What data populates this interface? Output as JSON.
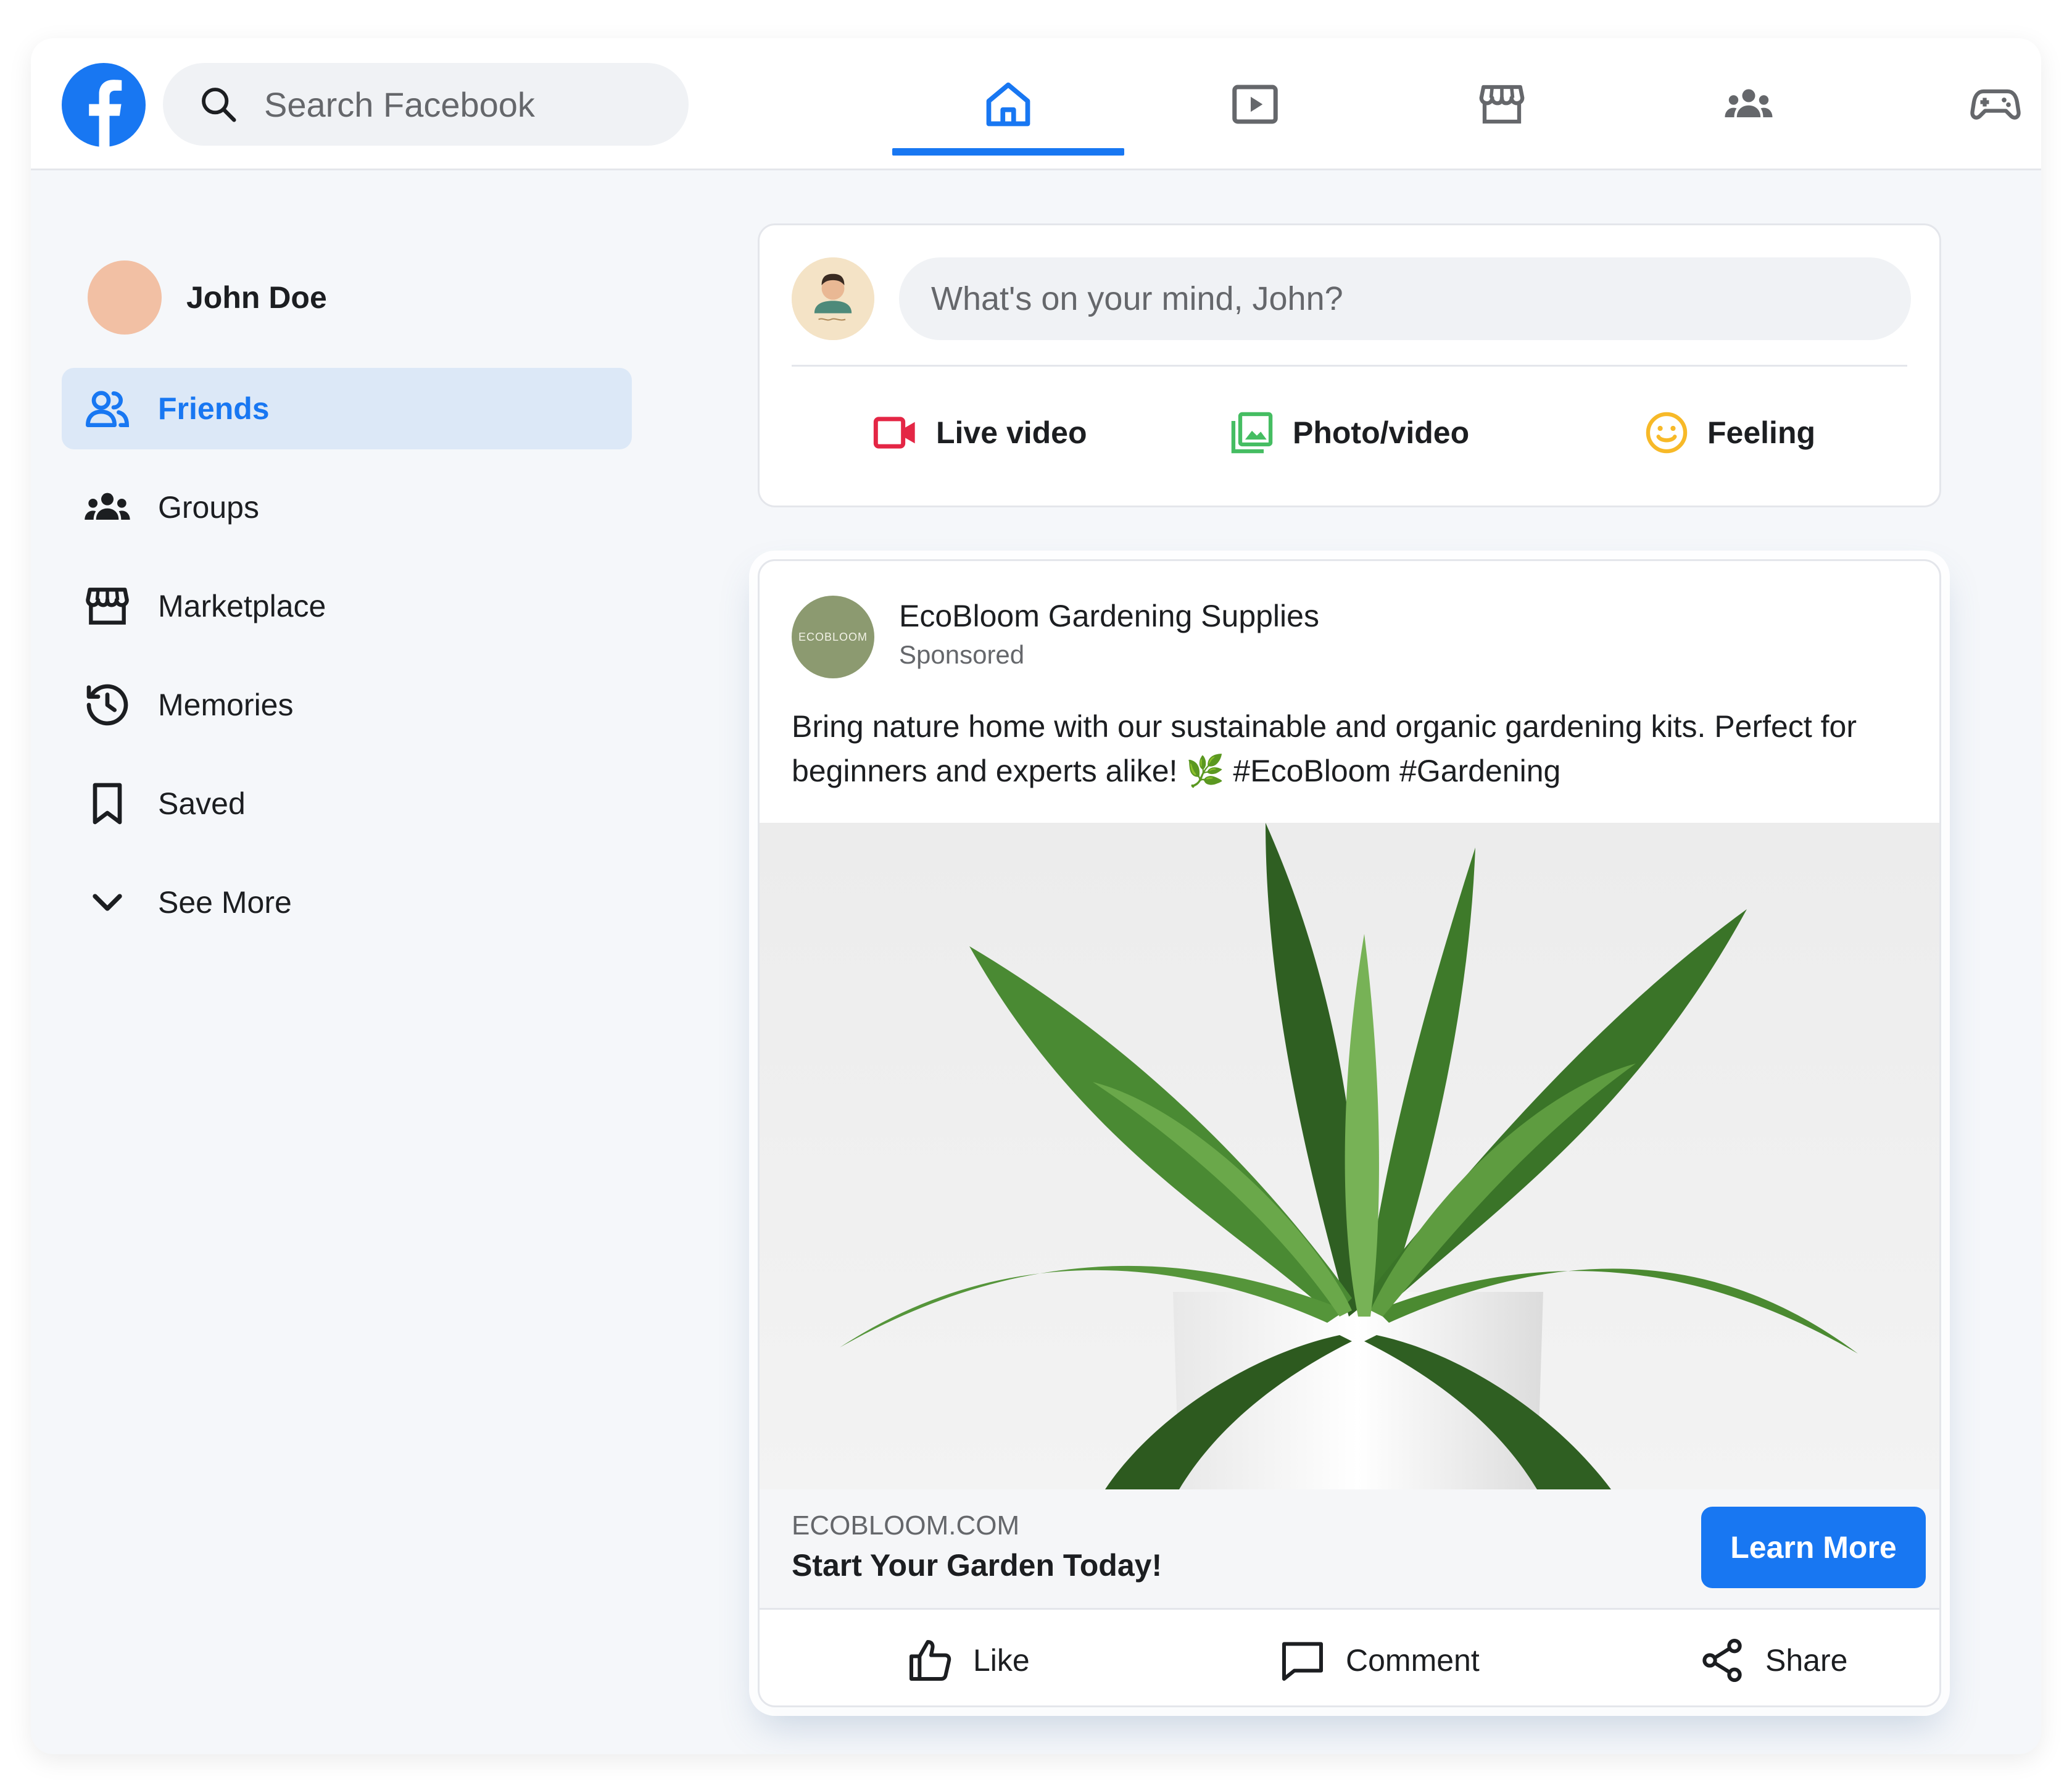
{
  "header": {
    "search_placeholder": "Search Facebook",
    "nav": [
      "home",
      "watch",
      "marketplace",
      "groups",
      "gaming"
    ],
    "active_nav": "home",
    "accent": "#1877f2"
  },
  "sidebar": {
    "profile_name": "John Doe",
    "items": [
      {
        "label": "Friends",
        "icon": "friends-icon",
        "active": true
      },
      {
        "label": "Groups",
        "icon": "groups-icon"
      },
      {
        "label": "Marketplace",
        "icon": "marketplace-icon"
      },
      {
        "label": "Memories",
        "icon": "memories-icon"
      },
      {
        "label": "Saved",
        "icon": "saved-icon"
      },
      {
        "label": "See More",
        "icon": "chevron-down-icon"
      }
    ]
  },
  "composer": {
    "placeholder": "What's on your mind, John?",
    "actions": [
      {
        "label": "Live video",
        "icon": "live-video-icon",
        "color": "#e42645"
      },
      {
        "label": "Photo/video",
        "icon": "photo-video-icon",
        "color": "#45bd62"
      },
      {
        "label": "Feeling",
        "icon": "feeling-icon",
        "color": "#f7b928"
      }
    ]
  },
  "ad": {
    "page_name": "EcoBloom Gardening Supplies",
    "avatar_text": "ECOBLOOM",
    "sponsored": "Sponsored",
    "text": "Bring nature home with our sustainable and organic gardening kits. Perfect for beginners and experts alike! 🌿 #EcoBloom #Gardening",
    "domain": "ECOBLOOM.COM",
    "headline": "Start Your Garden Today!",
    "cta": "Learn More",
    "actions": [
      {
        "label": "Like",
        "icon": "like-icon"
      },
      {
        "label": "Comment",
        "icon": "comment-icon"
      },
      {
        "label": "Share",
        "icon": "share-icon"
      }
    ]
  }
}
